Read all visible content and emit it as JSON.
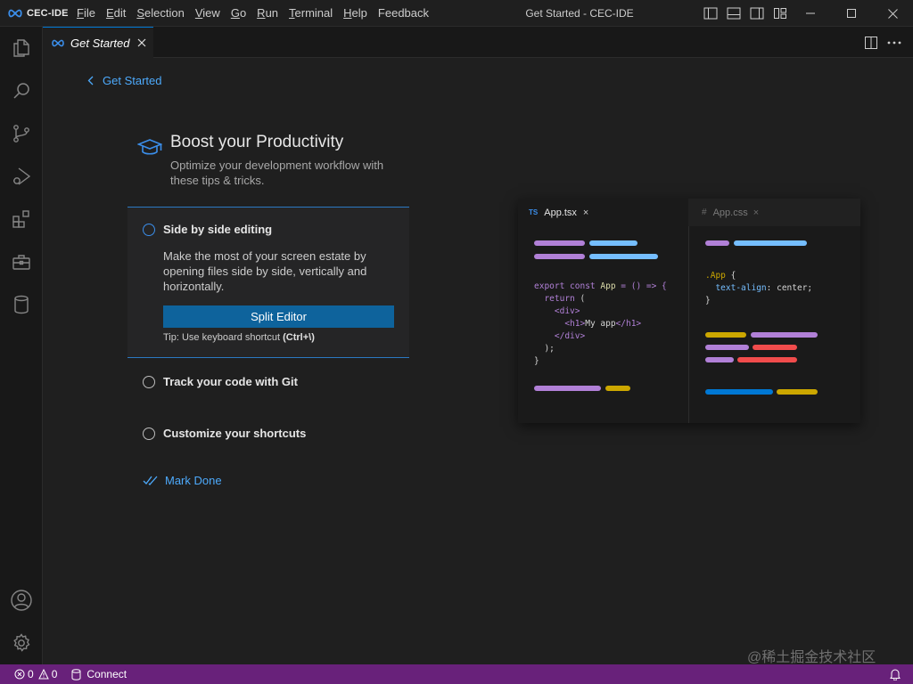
{
  "app": {
    "logo_text": "CEC-IDE",
    "window_title": "Get Started - CEC-IDE",
    "menu": [
      "File",
      "Edit",
      "Selection",
      "View",
      "Go",
      "Run",
      "Terminal",
      "Help",
      "Feedback"
    ]
  },
  "tabs": [
    {
      "label": "Get Started",
      "active": true
    }
  ],
  "walkthrough": {
    "back_label": "Get Started",
    "title": "Boost your Productivity",
    "subtitle": "Optimize your development workflow with these tips & tricks.",
    "steps": [
      {
        "title": "Side by side editing",
        "description": "Make the most of your screen estate by opening files side by side, vertically and horizontally.",
        "button_label": "Split Editor",
        "tip_prefix": "Tip: Use keyboard shortcut ",
        "tip_shortcut": "(Ctrl+\\)",
        "expanded": true
      },
      {
        "title": "Track your code with Git",
        "expanded": false
      },
      {
        "title": "Customize your shortcuts",
        "expanded": false
      }
    ],
    "mark_done_label": "Mark Done"
  },
  "preview": {
    "left_tab": {
      "badge": "TS",
      "name": "App.tsx",
      "close": "×"
    },
    "right_tab": {
      "badge": "#",
      "name": "App.css",
      "close": "×"
    },
    "left_code": "export const App = () => {\n  return (\n    <div>\n      <h1>My app</h1>\n    </div>\n  );\n}",
    "right_code": ".App {\n  text-align: center;\n}",
    "colors": {
      "purple": "#b180d7",
      "blue": "#75beff",
      "yellow": "#cca700",
      "red": "#f14c4c",
      "darkblue": "#0078d4"
    }
  },
  "statusbar": {
    "errors": "0",
    "warnings": "0",
    "connect_label": "Connect",
    "background": "#68217a"
  },
  "watermark": "@稀土掘金技术社区"
}
